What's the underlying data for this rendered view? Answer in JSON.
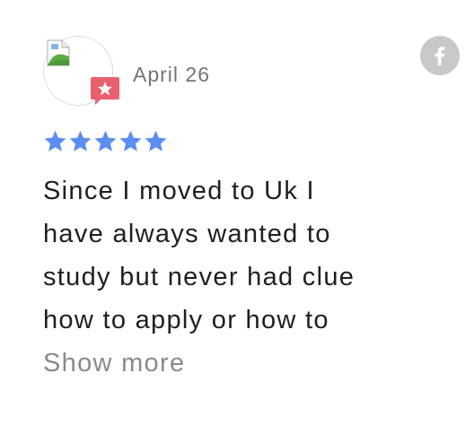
{
  "review": {
    "date": "April 26",
    "rating": 5,
    "rating_max": 5,
    "text": "Since I moved to Uk I\nhave always wanted to\nstudy but never had clue\nhow to apply or how to",
    "show_more_label": "Show more",
    "avatar_icon": "broken-image-icon",
    "badge_icon": "star-badge-icon",
    "share_icon": "facebook-icon"
  },
  "colors": {
    "star": "#5c8df0",
    "badge": "#e8606e",
    "share_bg": "#c8c8c8",
    "date_text": "#757575",
    "body_text": "#1f1f1f",
    "show_more_text": "#8a8a8a"
  }
}
